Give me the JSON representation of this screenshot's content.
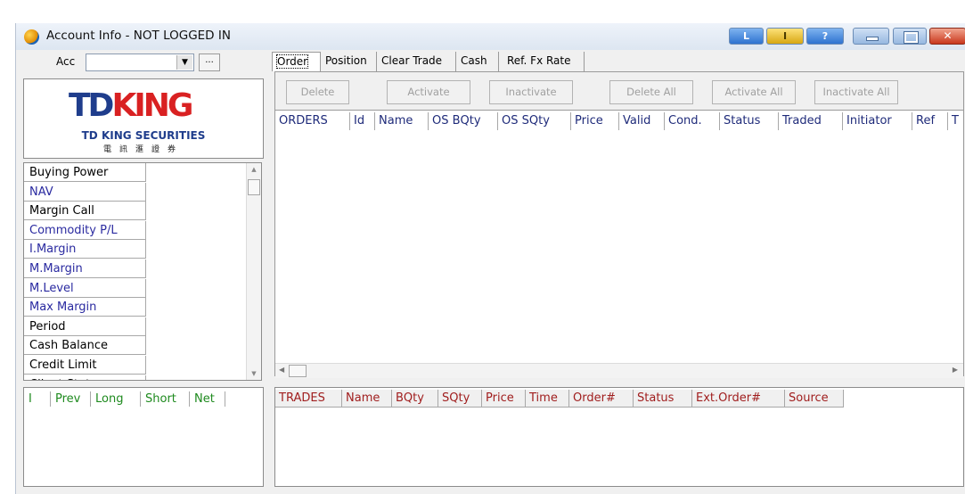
{
  "window": {
    "title": "Account Info - NOT LOGGED IN"
  },
  "title_buttons": {
    "l": "L",
    "i": "I",
    "help": "?"
  },
  "account": {
    "label": "Acc",
    "value": "",
    "browse": "..."
  },
  "logo": {
    "td": "TD",
    "king": "KING",
    "subtitle": "TD KING SECURITIES",
    "chinese": "電訊滙證券"
  },
  "account_items": [
    {
      "label": "Buying Power",
      "color": "black"
    },
    {
      "label": "NAV",
      "color": "blue"
    },
    {
      "label": "Margin Call",
      "color": "black"
    },
    {
      "label": "Commodity P/L",
      "color": "blue"
    },
    {
      "label": "I.Margin",
      "color": "blue"
    },
    {
      "label": "M.Margin",
      "color": "blue"
    },
    {
      "label": "M.Level",
      "color": "blue"
    },
    {
      "label": "Max Margin",
      "color": "blue"
    },
    {
      "label": "Period",
      "color": "black"
    },
    {
      "label": "Cash Balance",
      "color": "black"
    },
    {
      "label": "Credit Limit",
      "color": "black"
    },
    {
      "label": "Client Status",
      "color": "black"
    }
  ],
  "position_columns": [
    "I",
    "Prev",
    "Long",
    "Short",
    "Net"
  ],
  "tabs": [
    "Order",
    "Position",
    "Clear Trade",
    "Cash",
    "Ref. Fx Rate"
  ],
  "order_buttons": [
    "Delete",
    "Activate",
    "Inactivate",
    "Delete All",
    "Activate All",
    "Inactivate All"
  ],
  "order_columns": [
    "ORDERS",
    "Id",
    "Name",
    "OS BQty",
    "OS SQty",
    "Price",
    "Valid",
    "Cond.",
    "Status",
    "Traded",
    "Initiator",
    "Ref",
    "T"
  ],
  "trade_columns": [
    "TRADES",
    "Name",
    "BQty",
    "SQty",
    "Price",
    "Time",
    "Order#",
    "Status",
    "Ext.Order#",
    "Source"
  ],
  "colors": {
    "title_bg": "#dde6f1",
    "logo_blue": "#1f3d8c",
    "logo_red": "#d92122",
    "position_header": "#1e8a1e",
    "order_header": "#1f2b7a",
    "trade_header": "#a01e1e"
  }
}
